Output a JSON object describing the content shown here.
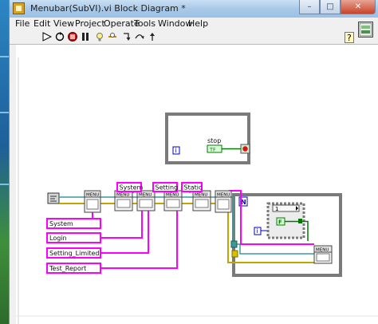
{
  "window": {
    "title": "Menubar(SubVI).vi Block Diagram *",
    "minimize_glyph": "–",
    "maximize_glyph": "□",
    "close_glyph": "✕"
  },
  "menus": [
    "File",
    "Edit",
    "View",
    "Project",
    "Operate",
    "Tools",
    "Window",
    "Help"
  ],
  "toolbar": {
    "icons": [
      "run-arrow-icon",
      "run-continuously-icon",
      "abort-icon",
      "pause-icon",
      "highlight-execution-icon",
      "retain-wire-values-icon",
      "step-into-icon",
      "step-over-icon",
      "step-out-icon",
      "context-help-icon"
    ]
  },
  "diagram": {
    "stop_label": "stop",
    "stop_bool": "TF",
    "loop_index": "i",
    "menu_node_label": "MENU",
    "top_strings": [
      "System",
      "Setting",
      "Static"
    ],
    "left_strings": [
      "System",
      "Login",
      "Setting_Limited",
      "Test_Report"
    ],
    "case_selector": "1",
    "n_terminal": "N",
    "bool_const": "F",
    "colors": {
      "string_wire": "#ff00ff",
      "refnum_wire": "#3a9a9a",
      "error_wire": "#bfa700",
      "boolean": "#007a00",
      "numeric": "#0000c8"
    }
  }
}
